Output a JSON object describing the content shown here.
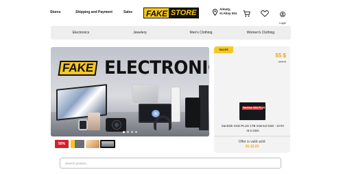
{
  "header": {
    "nav": [
      "Stores",
      "Shipping and Payment",
      "Sales"
    ],
    "logo_left": "FAKE",
    "logo_right": "STORE",
    "location_line1": "Almaty,",
    "location_line2": "st.Abay 52a",
    "login_label": "Login",
    "icons": [
      "location-pin-icon",
      "cart-icon",
      "heart-icon",
      "user-icon"
    ]
  },
  "categories": [
    "Electronics",
    "Jewelery",
    "Men's Clothing",
    "Women's Clothing"
  ],
  "banner": {
    "badge_text": "FAKE",
    "headline": "ELECTRONICS",
    "slide_count": 4,
    "active_slide": 1
  },
  "thumbnails": [
    {
      "label": "50%",
      "active": false
    },
    {
      "label": "",
      "active": false
    },
    {
      "label": "",
      "active": false
    },
    {
      "label": "",
      "active": true
    }
  ],
  "offer": {
    "badge": "SALES",
    "price": "55 $",
    "old_price": "109 $",
    "product_image_text": "SanDisk SSD PLUS",
    "product_name": "SanDisk SSD PLUS 1TB Internal SSD - SATA III 6 Gb/s",
    "valid_label": "Offer is valid until:",
    "valid_date": "31.12.23"
  },
  "search": {
    "placeholder": "Search product...",
    "value": ""
  },
  "colors": {
    "accent": "#f6c81f",
    "price": "#f2a100",
    "panel": "#eeeeee"
  }
}
